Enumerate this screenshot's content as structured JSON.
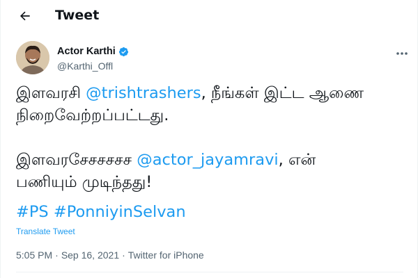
{
  "header": {
    "title": "Tweet",
    "back_icon": "back-arrow-icon"
  },
  "author": {
    "display_name": "Actor Karthi",
    "handle": "@Karthi_Offl",
    "verified": true,
    "verified_color": "#1d9bf0"
  },
  "tweet": {
    "line1_prefix": "இளவரசி ",
    "mention1": "@trishtrashers",
    "line1_suffix": ", நீங்கள் இட்ட ஆணை",
    "line2": "நிறைவேற்றப்பட்டது.",
    "line3_prefix": "இளவரசேசசசசச ",
    "mention2": "@actor_jayamravi",
    "line3_suffix": ", என்",
    "line4": "பணியும் முடிந்தது!",
    "hashtag1": "#PS",
    "hashtag2": "#PonniyinSelvan"
  },
  "translate_label": "Translate Tweet",
  "meta": {
    "time": "5:05 PM",
    "separator": "·",
    "date": "Sep 16, 2021",
    "source": "Twitter for iPhone"
  },
  "colors": {
    "link": "#1d9bf0",
    "secondary_text": "#536471",
    "primary_text": "#0f1419"
  }
}
